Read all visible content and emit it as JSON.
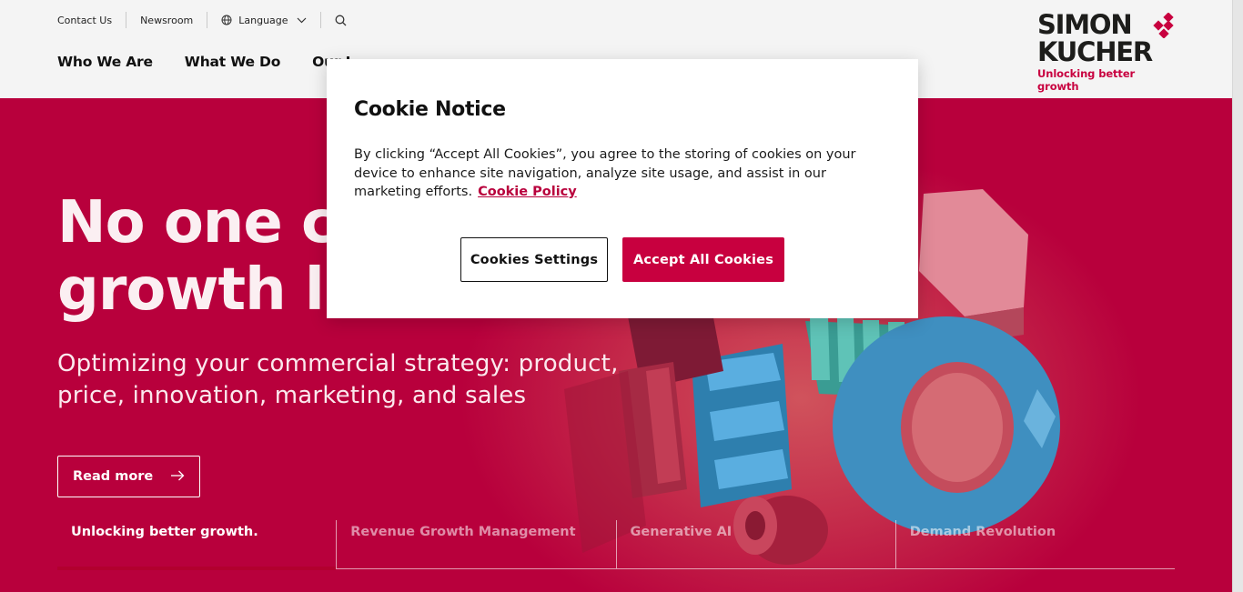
{
  "utility_nav": {
    "contact": "Contact Us",
    "newsroom": "Newsroom",
    "language": "Language"
  },
  "main_nav": [
    {
      "label": "Who We Are"
    },
    {
      "label": "What We Do"
    },
    {
      "label": "Our I"
    }
  ],
  "logo": {
    "line1": "SIMON",
    "line2": "KUCHER",
    "tagline": "Unlocking better growth"
  },
  "hero": {
    "headline_line1": "No one cre",
    "headline_line2": "growth lik",
    "subhead": "Optimizing your commercial strategy: product, price, innovation, marketing, and sales",
    "read_more": "Read more",
    "tabs": [
      {
        "label": "Unlocking better growth.",
        "active": true
      },
      {
        "label": "Revenue Growth Management",
        "active": false
      },
      {
        "label": "Generative AI",
        "active": false
      },
      {
        "label": "Demand Revolution",
        "active": false
      }
    ]
  },
  "cookie_modal": {
    "title": "Cookie Notice",
    "body": "By clicking “Accept All Cookies”, you agree to the storing of cookies on your device to enhance site navigation, analyze site usage, and assist in our marketing efforts.",
    "policy_link": "Cookie Policy",
    "settings_button": "Cookies Settings",
    "accept_button": "Accept All Cookies"
  },
  "colors": {
    "brand": "#c8003f",
    "hero_bg": "#b8003c",
    "header_bg": "#f4f4f4"
  },
  "icons": [
    "globe-icon",
    "chevron-down-icon",
    "search-icon",
    "arrow-right-icon",
    "logo-diamonds-icon"
  ]
}
